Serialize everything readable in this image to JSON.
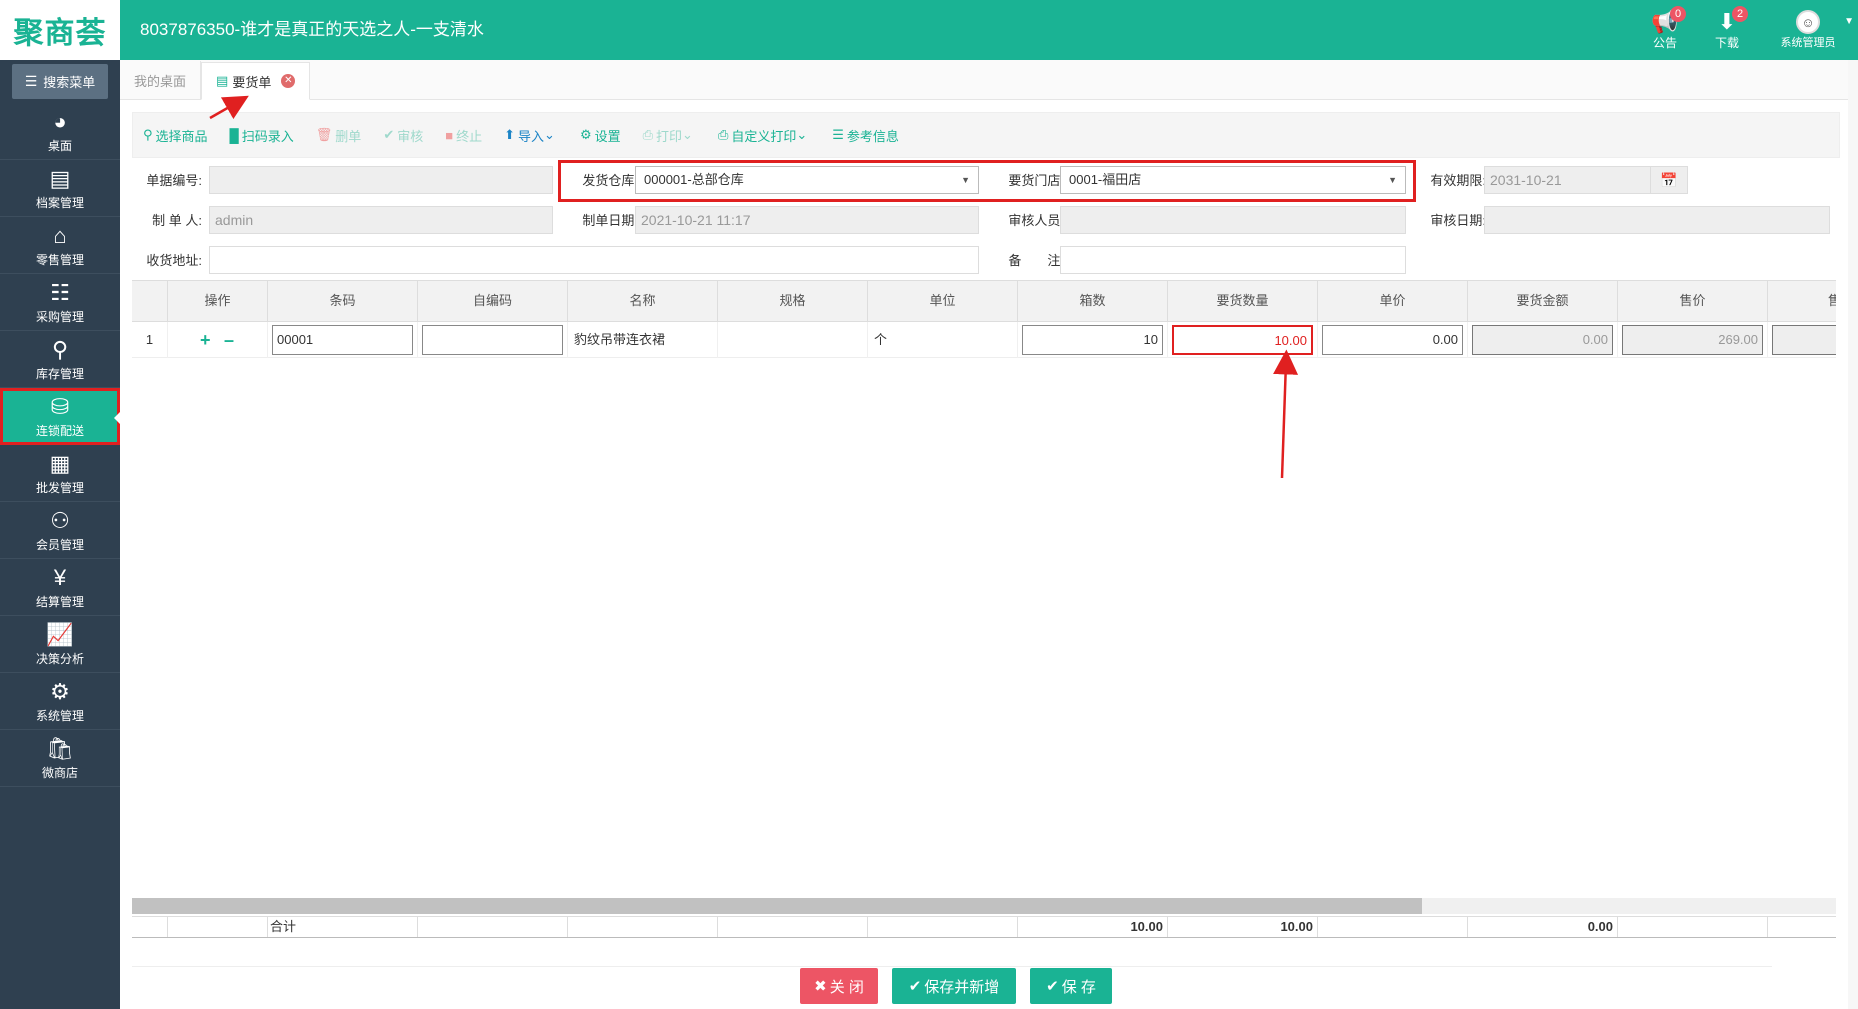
{
  "header": {
    "logo": "聚商荟",
    "title": "8037876350-谁才是真正的天选之人-一支清水",
    "notice_label": "公告",
    "notice_count": "0",
    "download_label": "下载",
    "download_count": "2",
    "user_label": "系统管理员"
  },
  "sidebar": {
    "search_label": "搜索菜单",
    "items": [
      {
        "label": "桌面",
        "icon": "dashboard-icon"
      },
      {
        "label": "档案管理",
        "icon": "archive-icon"
      },
      {
        "label": "零售管理",
        "icon": "store-icon"
      },
      {
        "label": "采购管理",
        "icon": "cart-icon"
      },
      {
        "label": "库存管理",
        "icon": "inventory-icon"
      },
      {
        "label": "连锁配送",
        "icon": "truck-icon"
      },
      {
        "label": "批发管理",
        "icon": "wholesale-icon"
      },
      {
        "label": "会员管理",
        "icon": "member-icon"
      },
      {
        "label": "结算管理",
        "icon": "settlement-icon"
      },
      {
        "label": "决策分析",
        "icon": "analysis-icon"
      },
      {
        "label": "系统管理",
        "icon": "gear-icon"
      },
      {
        "label": "微商店",
        "icon": "shop-bag-icon"
      }
    ]
  },
  "tabs": [
    {
      "label": "我的桌面"
    },
    {
      "label": "要货单"
    }
  ],
  "toolbar": {
    "select_goods": "选择商品",
    "scan_entry": "扫码录入",
    "delete": "删单",
    "audit": "审核",
    "terminate": "终止",
    "import": "导入",
    "settings": "设置",
    "print": "打印",
    "custom_print": "自定义打印",
    "reference": "参考信息"
  },
  "form": {
    "doc_no_label": "单据编号:",
    "doc_no_value": "",
    "warehouse_label": "发货仓库:",
    "warehouse_value": "000001-总部仓库",
    "store_label": "要货门店:",
    "store_value": "0001-福田店",
    "valid_label": "有效期限:",
    "valid_value": "2031-10-21",
    "maker_label": "制 单 人:",
    "maker_value": "admin",
    "make_date_label": "制单日期:",
    "make_date_value": "2021-10-21 11:17",
    "auditor_label": "审核人员:",
    "auditor_value": "",
    "audit_date_label": "审核日期:",
    "audit_date_value": "",
    "address_label": "收货地址:",
    "address_value": "",
    "remark_label": "备　　注:",
    "remark_value": ""
  },
  "grid": {
    "columns": [
      "操作",
      "条码",
      "自编码",
      "名称",
      "规格",
      "单位",
      "箱数",
      "要货数量",
      "单价",
      "要货金额",
      "售价",
      "售"
    ],
    "rows": [
      {
        "index": "1",
        "barcode": "00001",
        "code": "",
        "name": "豹纹吊带连衣裙",
        "spec": "",
        "unit": "个",
        "boxes": "10",
        "qty": "10.00",
        "price": "0.00",
        "amount": "0.00",
        "sale_price": "269.00"
      }
    ],
    "footer": {
      "label": "合计",
      "boxes": "10.00",
      "qty": "10.00",
      "amount": "0.00"
    }
  },
  "buttons": {
    "close": "关 闭",
    "save_new": "保存并新增",
    "save": "保 存"
  },
  "colors": {
    "brand": "#1ab394",
    "sidebar": "#2f4050",
    "danger": "#ed5565",
    "highlight": "#e02020"
  }
}
